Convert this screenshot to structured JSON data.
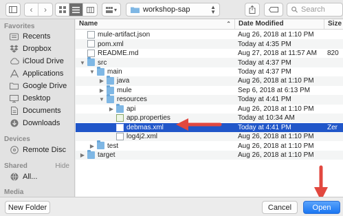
{
  "toolbar": {
    "path_label": "workshop-sap",
    "search_placeholder": "Search"
  },
  "sidebar": {
    "favorites_label": "Favorites",
    "favorites": [
      {
        "label": "Recents",
        "icon": "recents-icon"
      },
      {
        "label": "Dropbox",
        "icon": "dropbox-icon"
      },
      {
        "label": "iCloud Drive",
        "icon": "cloud-icon"
      },
      {
        "label": "Applications",
        "icon": "applications-icon"
      },
      {
        "label": "Google Drive",
        "icon": "folder-icon"
      },
      {
        "label": "Desktop",
        "icon": "desktop-icon"
      },
      {
        "label": "Documents",
        "icon": "documents-icon"
      },
      {
        "label": "Downloads",
        "icon": "downloads-icon"
      }
    ],
    "devices_label": "Devices",
    "devices": [
      {
        "label": "Remote Disc",
        "icon": "disc-icon"
      }
    ],
    "shared_label": "Shared",
    "shared_hide": "Hide",
    "shared": [
      {
        "label": "All...",
        "icon": "network-icon"
      }
    ],
    "media_label": "Media"
  },
  "list": {
    "columns": {
      "name": "Name",
      "date": "Date Modified",
      "size": "Size"
    },
    "rows": [
      {
        "name": "mule-artifact.json",
        "date": "Aug 26, 2018 at 1:10 PM",
        "size": "",
        "kind": "doc"
      },
      {
        "name": "pom.xml",
        "date": "Today at 4:35 PM",
        "size": "",
        "kind": "doc"
      },
      {
        "name": "README.md",
        "date": "Aug 27, 2018 at 11:57 AM",
        "size": "820",
        "kind": "doc"
      },
      {
        "name": "src",
        "date": "Today at 4:37 PM",
        "size": "",
        "kind": "folder",
        "disc": "▼"
      },
      {
        "name": "main",
        "date": "Today at 4:37 PM",
        "size": "",
        "kind": "folder",
        "disc": "▼"
      },
      {
        "name": "java",
        "date": "Aug 26, 2018 at 1:10 PM",
        "size": "",
        "kind": "folder",
        "disc": "▶"
      },
      {
        "name": "mule",
        "date": "Sep 6, 2018 at 6:13 PM",
        "size": "",
        "kind": "folder",
        "disc": "▶"
      },
      {
        "name": "resources",
        "date": "Today at 4:41 PM",
        "size": "",
        "kind": "folder",
        "disc": "▼"
      },
      {
        "name": "api",
        "date": "Aug 26, 2018 at 1:10 PM",
        "size": "",
        "kind": "folder",
        "disc": "▶"
      },
      {
        "name": "app.properties",
        "date": "Today at 10:34 AM",
        "size": "",
        "kind": "doc-green"
      },
      {
        "name": "debmas.xml",
        "date": "Today at 4:41 PM",
        "size": "Zer",
        "kind": "doc",
        "selected": true
      },
      {
        "name": "log4j2.xml",
        "date": "Aug 26, 2018 at 1:10 PM",
        "size": "",
        "kind": "doc"
      },
      {
        "name": "test",
        "date": "Aug 26, 2018 at 1:10 PM",
        "size": "",
        "kind": "folder",
        "disc": "▶"
      },
      {
        "name": "target",
        "date": "Aug 26, 2018 at 1:10 PM",
        "size": "",
        "kind": "folder",
        "disc": "▶"
      }
    ]
  },
  "footer": {
    "new_folder": "New Folder",
    "cancel": "Cancel",
    "open": "Open"
  },
  "colors": {
    "selection": "#2056c9",
    "annotation_arrow": "#e2483f",
    "primary_button": "#1a76f2"
  }
}
